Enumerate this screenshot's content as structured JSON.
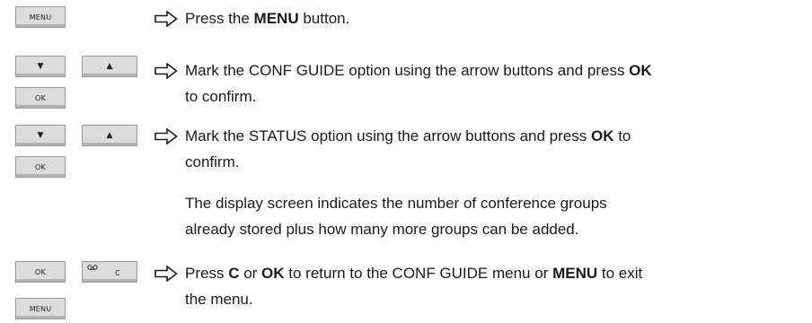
{
  "keys": {
    "menu": "MENU",
    "down": "▼",
    "up": "▲",
    "ok": "OK",
    "c": "C"
  },
  "steps": [
    {
      "pre": "Press the ",
      "bold": "MENU",
      "post": " button."
    },
    {
      "pre": "Mark the CONF GUIDE option using the arrow buttons and press ",
      "bold": "OK",
      "post": "",
      "line2": "to confirm."
    },
    {
      "pre": "Mark the STATUS option using the arrow buttons and press ",
      "bold": "OK",
      "post": " to",
      "line2": "confirm."
    },
    {
      "pre": "Press ",
      "bold": "C",
      "mid": " or ",
      "bold2": "OK",
      "post": " to return to the CONF GUIDE menu or ",
      "bold3": "MENU",
      "post2": " to exit",
      "line2": "the menu."
    }
  ],
  "note": {
    "line1": "The display screen indicates the number of conference groups",
    "line2": "already stored plus how many more groups can be added."
  },
  "icons": {
    "pointer": "hollow-right-arrow-icon",
    "voicemail": "voicemail-icon"
  }
}
